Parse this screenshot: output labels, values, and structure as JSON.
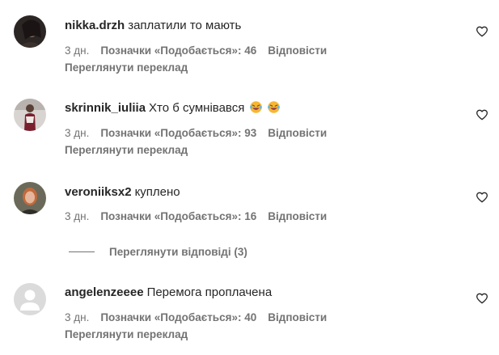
{
  "comments": [
    {
      "username": "nikka.drzh",
      "text": "заплатили то мають",
      "emoji": "",
      "time": "3 дн.",
      "likes": "Позначки «Подобається»: 46",
      "reply": "Відповісти",
      "translate": "Переглянути переклад"
    },
    {
      "username": "skrinnik_iuliia",
      "text": "Хто б сумнівався",
      "emoji": "laughing-tears-emoji",
      "time": "3 дн.",
      "likes": "Позначки «Подобається»: 93",
      "reply": "Відповісти",
      "translate": "Переглянути переклад"
    },
    {
      "username": "veroniiksx2",
      "text": "куплено",
      "emoji": "",
      "time": "3 дн.",
      "likes": "Позначки «Подобається»: 16",
      "reply": "Відповісти",
      "translate": ""
    },
    {
      "username": "angelenzeeee",
      "text": "Перемога проплачена",
      "emoji": "",
      "time": "3 дн.",
      "likes": "Позначки «Подобається»: 40",
      "reply": "Відповісти",
      "translate": "Переглянути переклад"
    }
  ],
  "view_replies": "Переглянути відповіді (3)",
  "icons": {
    "like": "heart-outline-icon",
    "emoji": "laughing-tears-emoji"
  },
  "colors": {
    "primary_text": "#262626",
    "secondary_text": "#737373"
  }
}
